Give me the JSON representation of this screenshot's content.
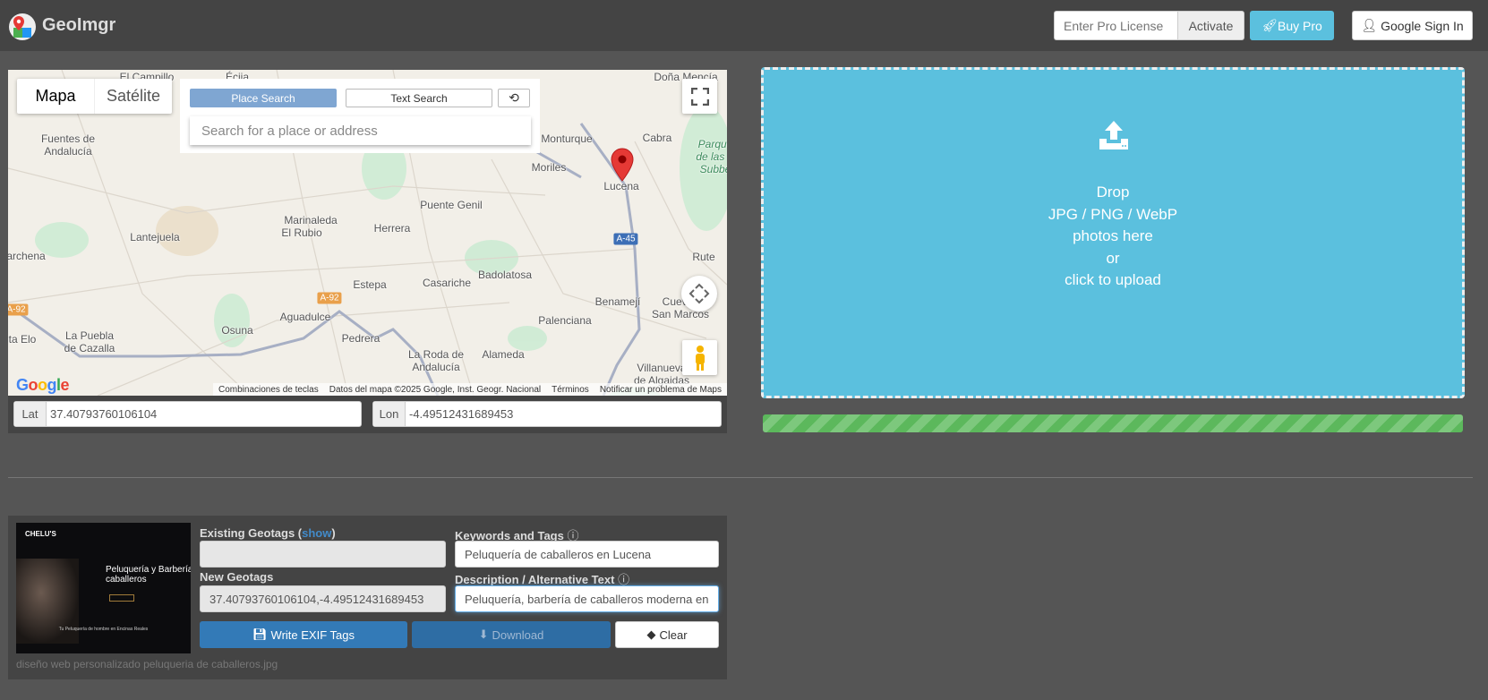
{
  "header": {
    "brand": "GeoImgr",
    "license_placeholder": "Enter Pro License",
    "activate": "Activate",
    "buy_pro": "Buy Pro",
    "sign_in": "Google Sign In"
  },
  "map": {
    "type_map": "Mapa",
    "type_satellite": "Satélite",
    "place_search": "Place Search",
    "text_search": "Text Search",
    "search_placeholder": "Search for a place or address",
    "labels": [
      "El Campillo",
      "Écija",
      "Doña Mencía",
      "Fuentes de",
      "Andalucía",
      "Monturque",
      "Cabra",
      "Parque",
      "de las S",
      "Subbé",
      "Moriles",
      "Lucena",
      "Puente Genil",
      "Marinaleda",
      "El Rubio",
      "Herrera",
      "Lantejuela",
      "archena",
      "Rute",
      "Badolatosa",
      "Casariche",
      "Estepa",
      "Aguadulce",
      "Benamejí",
      "Cuevas",
      "San Marcos",
      "Palenciana",
      "Osuna",
      "La Puebla",
      "de Cazalla",
      "ta Elo",
      "Pedrera",
      "La Roda de",
      "Andalucía",
      "Alameda",
      "Villanueva",
      "de Algaidas"
    ],
    "road_badges": [
      "A-45",
      "A-92",
      "A-92"
    ],
    "google": "Google",
    "attribution": [
      "Combinaciones de teclas",
      "Datos del mapa ©2025 Google, Inst. Geogr. Nacional",
      "Términos",
      "Notificar un problema de Maps"
    ]
  },
  "coords": {
    "lat_label": "Lat",
    "lat": "37.40793760106104",
    "lon_label": "Lon",
    "lon": "-4.49512431689453"
  },
  "dropzone": {
    "lines": [
      "Drop",
      "JPG / PNG / WebP",
      "photos here",
      "or",
      "click to upload"
    ]
  },
  "upload_progress": 100,
  "file": {
    "thumb": {
      "brand": "CHELU'S",
      "headline1": "Peluquería y Barbería p",
      "headline2": "caballeros",
      "footer": "Tu Peluquería de hombre en Encinas Reales"
    },
    "existing_label": "Existing Geotags (",
    "show": "show",
    "existing_close": ")",
    "existing_value": "",
    "new_label": "New Geotags",
    "new_value": "37.40793760106104,-4.49512431689453",
    "keywords_label": "Keywords and Tags",
    "keywords_value": "Peluquería de caballeros en Lucena",
    "desc_label": "Description / Alternative Text",
    "desc_value": "Peluquería, barbería de caballeros moderna en Lucena",
    "write": "Write EXIF Tags",
    "download": "Download",
    "clear": "Clear",
    "filename": "diseño web personalizado peluqueria de caballeros.jpg"
  },
  "colors": {
    "header": "#444444",
    "background": "#555555",
    "dropzone": "#5bc0de",
    "progress": "#5cb85c",
    "primary": "#337ab7"
  }
}
